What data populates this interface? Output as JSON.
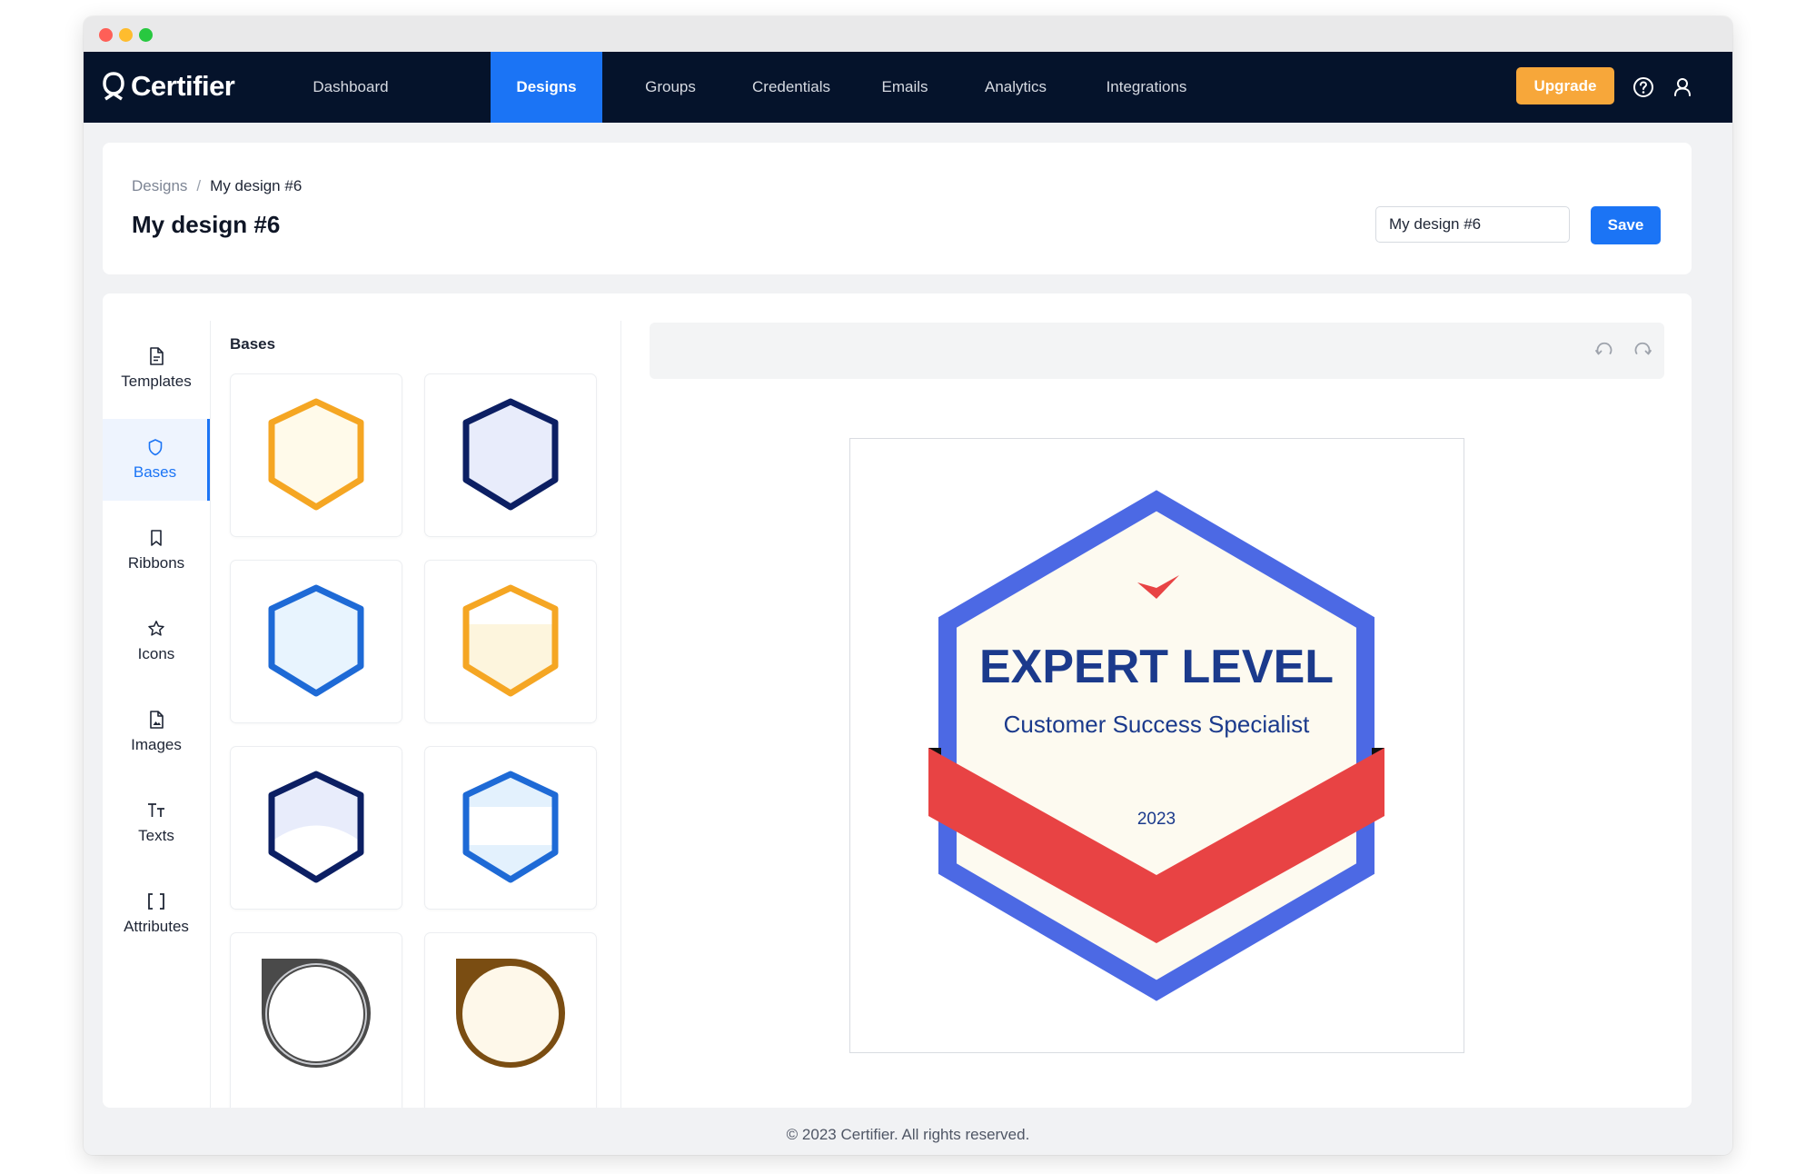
{
  "brand": {
    "name": "Certifier"
  },
  "nav": {
    "items": [
      {
        "label": "Dashboard"
      },
      {
        "label": "Designs"
      },
      {
        "label": "Groups"
      },
      {
        "label": "Credentials"
      },
      {
        "label": "Emails"
      },
      {
        "label": "Analytics"
      },
      {
        "label": "Integrations"
      }
    ],
    "active": "Designs",
    "upgrade_label": "Upgrade",
    "icons": [
      "help-icon",
      "user-icon"
    ]
  },
  "header": {
    "breadcrumb": [
      "Designs",
      "My design #6"
    ],
    "separator": "/",
    "title": "My design #6",
    "name_input_value": "My design #6",
    "save_label": "Save"
  },
  "sidebar": {
    "items": [
      {
        "label": "Templates",
        "icon": "file-icon"
      },
      {
        "label": "Bases",
        "icon": "shield-icon"
      },
      {
        "label": "Ribbons",
        "icon": "bookmark-icon"
      },
      {
        "label": "Icons",
        "icon": "star-icon"
      },
      {
        "label": "Images",
        "icon": "image-file-icon"
      },
      {
        "label": "Texts",
        "icon": "text-icon"
      },
      {
        "label": "Attributes",
        "icon": "brackets-icon"
      }
    ],
    "active": "Bases"
  },
  "bases": {
    "title": "Bases",
    "tiles": [
      "hexagon-orange",
      "hexagon-navy",
      "hexagon-blue",
      "hexagon-orange-half",
      "hexagon-navy-wave",
      "hexagon-blue-band",
      "circle-gray",
      "circle-brown"
    ]
  },
  "toolbar": {
    "icons": [
      "undo-icon",
      "redo-icon"
    ]
  },
  "badge": {
    "title": "EXPERT LEVEL",
    "subtitle": "Customer Success Specialist",
    "year": "2023",
    "colors": {
      "border": "#4c69e4",
      "fill": "#fdfaf0",
      "ribbon": "#e84344",
      "title": "#1b3a8c",
      "check": "#e84344"
    }
  },
  "colors": {
    "accent": "#1b74f5",
    "nav_bg": "#05132b",
    "upgrade": "#f7a73a"
  },
  "footer": {
    "text": "© 2023 Certifier. All rights reserved."
  }
}
